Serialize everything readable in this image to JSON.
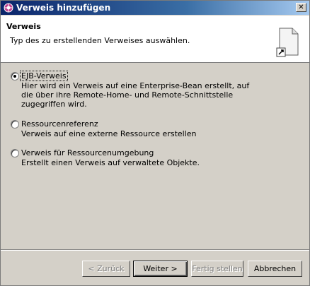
{
  "window": {
    "title": "Verweis hinzufügen",
    "close_glyph": "✕"
  },
  "header": {
    "title": "Verweis",
    "description": "Typ des zu erstellenden Verweises auswählen."
  },
  "options": [
    {
      "label": "EJB-Verweis",
      "checked": true,
      "description": "Hier wird ein Verweis auf eine Enterprise-Bean erstellt, auf die über ihre Remote-Home- und Remote-Schnittstelle zugegriffen wird."
    },
    {
      "label": "Ressourcenreferenz",
      "checked": false,
      "description": "Verweis auf eine externe Ressource erstellen"
    },
    {
      "label": "Verweis für Ressourcenumgebung",
      "checked": false,
      "description": "Erstellt einen Verweis auf verwaltete Objekte."
    }
  ],
  "buttons": {
    "back": "< Zurück",
    "next": "Weiter >",
    "finish": "Fertig stellen",
    "cancel": "Abbrechen"
  },
  "colors": {
    "titlebar": "#0a246a",
    "face": "#d4d0c8"
  }
}
